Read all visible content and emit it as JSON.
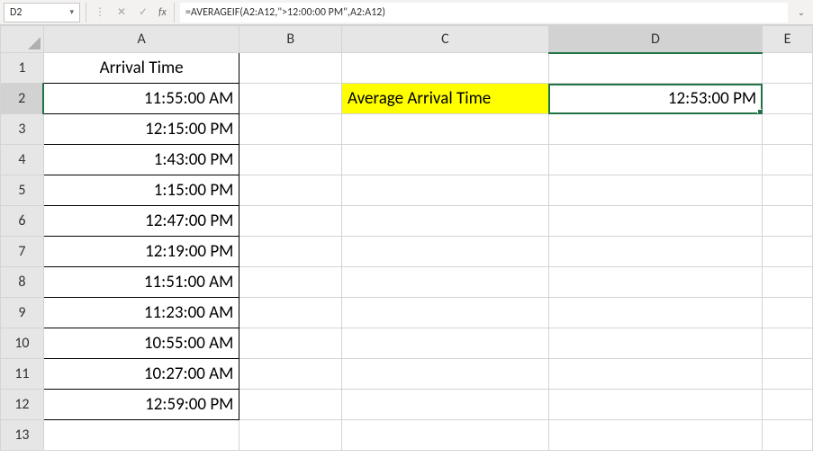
{
  "formula_bar": {
    "cell_ref": "D2",
    "formula": "=AVERAGEIF(A2:A12,\">12:00:00 PM\",A2:A12)",
    "fx_label": "fx",
    "cancel_glyph": "✕",
    "confirm_glyph": "✓",
    "ellipsis_glyph": "⋮",
    "caret_glyph": "▾",
    "expand_glyph": "⌄"
  },
  "columns": [
    "A",
    "B",
    "C",
    "D",
    "E"
  ],
  "rows": [
    "1",
    "2",
    "3",
    "4",
    "5",
    "6",
    "7",
    "8",
    "9",
    "10",
    "11",
    "12",
    "13"
  ],
  "active": {
    "col": "D",
    "row": "2"
  },
  "cells": {
    "A1": {
      "value": "Arrival Time",
      "align": "center",
      "bordered": true
    },
    "A2": {
      "value": "11:55:00 AM",
      "bordered": true
    },
    "A3": {
      "value": "12:15:00 PM",
      "bordered": true
    },
    "A4": {
      "value": "1:43:00 PM",
      "bordered": true
    },
    "A5": {
      "value": "1:15:00 PM",
      "bordered": true
    },
    "A6": {
      "value": "12:47:00 PM",
      "bordered": true
    },
    "A7": {
      "value": "12:19:00 PM",
      "bordered": true
    },
    "A8": {
      "value": "11:51:00 AM",
      "bordered": true
    },
    "A9": {
      "value": "11:23:00 AM",
      "bordered": true
    },
    "A10": {
      "value": "10:55:00 AM",
      "bordered": true
    },
    "A11": {
      "value": "10:27:00 AM",
      "bordered": true
    },
    "A12": {
      "value": "12:59:00 PM",
      "bordered": true
    },
    "C2": {
      "value": "Average Arrival Time",
      "align": "left",
      "yellow": true
    },
    "D2": {
      "value": "12:53:00 PM",
      "selected": true
    }
  }
}
